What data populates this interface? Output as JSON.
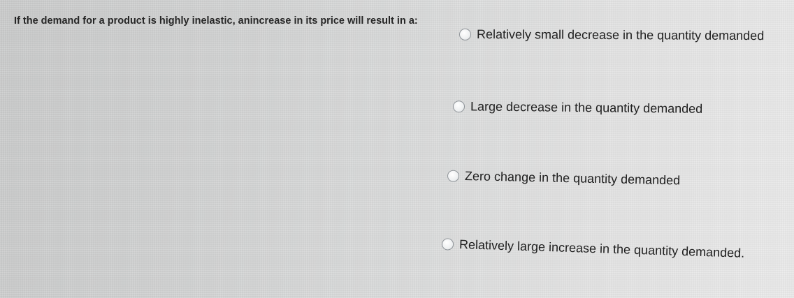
{
  "quiz": {
    "question": "If the demand for a product is highly inelastic, anincrease in its price will result in a:",
    "options": [
      {
        "label": "Relatively small decrease in the quantity demanded",
        "selected": false
      },
      {
        "label": "Large decrease in the quantity demanded",
        "selected": false
      },
      {
        "label": "Zero change in the quantity demanded",
        "selected": false
      },
      {
        "label": "Relatively large increase in the quantity demanded.",
        "selected": false
      }
    ]
  }
}
